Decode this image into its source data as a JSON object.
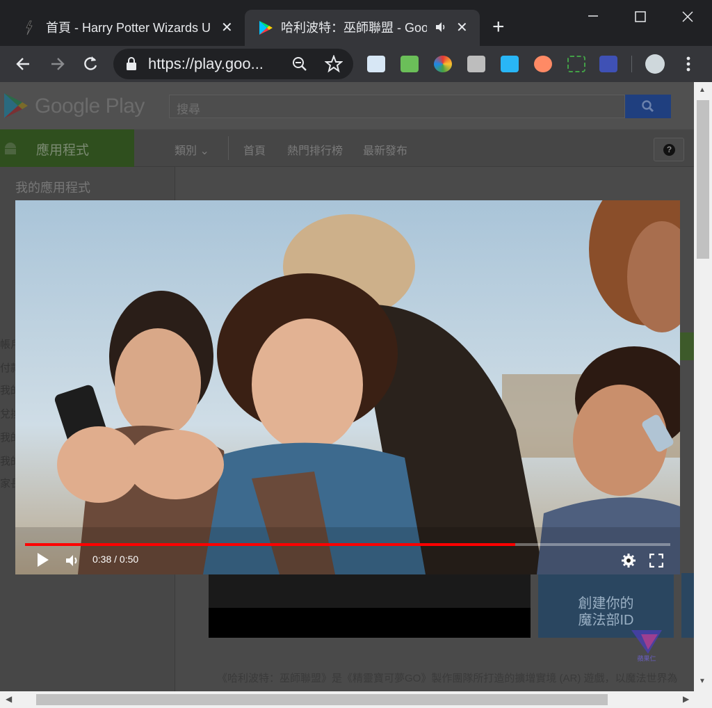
{
  "browser": {
    "tabs": [
      {
        "title": "首頁 - Harry Potter Wizards U",
        "active": false
      },
      {
        "title": "哈利波特：巫師聯盟 - Goo",
        "active": true
      }
    ],
    "url": "https://play.goo...",
    "extensions": [
      "note-extension-icon",
      "mail-check-extension-icon",
      "colorful-extension-icon",
      "bag-extension-icon",
      "share-arrow-extension-icon",
      "cartoon-face-extension-icon",
      "screenshot-frame-extension-icon",
      "key-search-extension-icon",
      "weather-profile-icon"
    ]
  },
  "page": {
    "logo_text": "Google Play",
    "search_placeholder": "搜尋",
    "apps_tab": "應用程式",
    "nav": [
      "類別",
      "首頁",
      "熱門排行榜",
      "最新發布"
    ],
    "help_symbol": "?",
    "sidebar_title": "我的應用程式",
    "sidebar_fragments": [
      "帳戶",
      "付款",
      "我的",
      "兌換",
      "我的",
      "我的",
      "家長"
    ],
    "promo_text_line1": "創建你的",
    "promo_text_line2": "魔法部ID",
    "description": "《哈利波特：巫師聯盟》是《精靈寶可夢GO》製作團隊所打造的擴增實境 (AR) 遊戲，以魔法世界為",
    "watermark_text": "蘋果仁"
  },
  "player": {
    "current_time": "0:38",
    "duration": "0:50",
    "time_display": "0:38 / 0:50",
    "progress_fraction": 0.76
  },
  "colors": {
    "progress": "#ff0000",
    "apps_green": "#2f4f1e",
    "search_blue": "#1f3f7f"
  }
}
